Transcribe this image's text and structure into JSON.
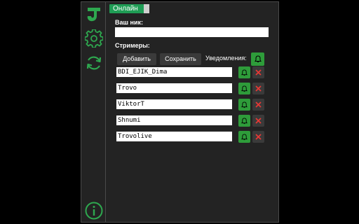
{
  "sidebar": {
    "logo_icon": "logo-icon",
    "settings_icon": "gear-icon",
    "refresh_icon": "refresh-icon",
    "info_icon": "info-icon"
  },
  "status": {
    "online_label": "Онлайн"
  },
  "nick": {
    "label": "Ваш ник:",
    "value": ""
  },
  "streamers": {
    "label": "Стримеры:",
    "add_label": "Добавить",
    "save_label": "Сохранить",
    "notifications_label": "Уведомления:",
    "items": [
      "BDI_EJIK_Dima",
      "Trovo",
      "ViktorT",
      "Shnumi",
      "Trovolive"
    ]
  },
  "colors": {
    "accent_green": "#2e9c3a",
    "online_green": "#1f9d55",
    "delete_red": "#e53935",
    "panel_bg": "#232323",
    "button_bg": "#3a3a3a"
  }
}
